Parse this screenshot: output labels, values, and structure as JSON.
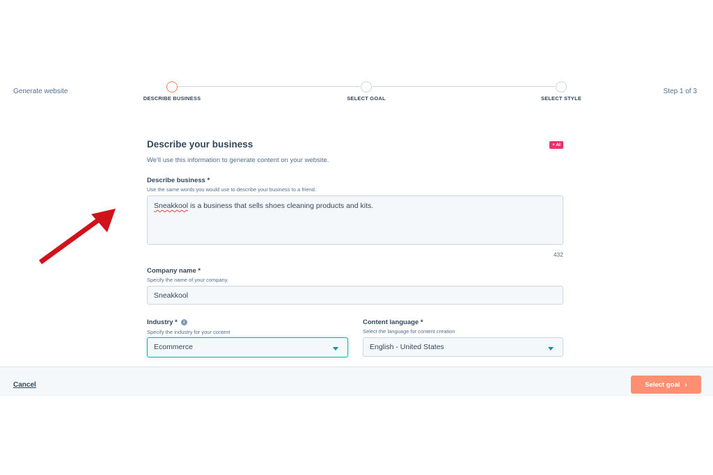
{
  "header": {
    "title": "Generate website",
    "step_counter": "Step 1 of 3",
    "steps": [
      {
        "label": "DESCRIBE BUSINESS",
        "active": true
      },
      {
        "label": "SELECT GOAL",
        "active": false
      },
      {
        "label": "SELECT STYLE",
        "active": false
      }
    ]
  },
  "form": {
    "title": "Describe your business",
    "ai_badge": "+ AI",
    "description": "We'll use this information to generate content on your website.",
    "business": {
      "label": "Describe business *",
      "hint": "Use the same words you would use to describe your business to a friend.",
      "value_word": "Sneakkool",
      "value_rest": " is a business that sells shoes cleaning products and kits.",
      "char_count": "432"
    },
    "company": {
      "label": "Company name *",
      "hint": "Specify the name of your company.",
      "value": "Sneakkool"
    },
    "industry": {
      "label": "Industry *",
      "info_icon": "i",
      "hint": "Specify the industry for your content",
      "value": "Ecommerce"
    },
    "language": {
      "label": "Content language *",
      "hint": "Select the language for content creation",
      "value": "English - United States"
    }
  },
  "footer": {
    "cancel_label": "Cancel",
    "next_label": "Select goal",
    "next_icon": "›"
  },
  "colors": {
    "accent_orange": "#ff7a59",
    "primary_button": "#ff8f73",
    "ai_badge": "#e8326a",
    "focus_border": "#00bda5",
    "annotation_arrow": "#d0121b"
  }
}
